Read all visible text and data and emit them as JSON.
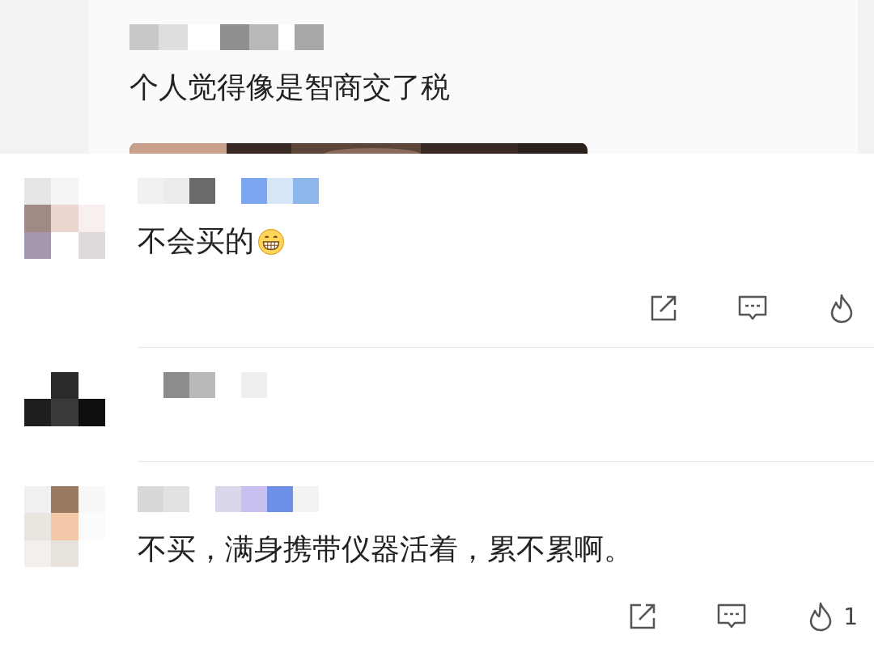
{
  "quoted": {
    "text": "个人觉得像是智商交了税"
  },
  "comments": [
    {
      "kind": "full",
      "text": "不会买的",
      "emoji": true
    },
    {
      "kind": "header"
    },
    {
      "kind": "full",
      "text": "不买，满身携带仪器活着，累不累啊。",
      "like_count": "1"
    }
  ]
}
